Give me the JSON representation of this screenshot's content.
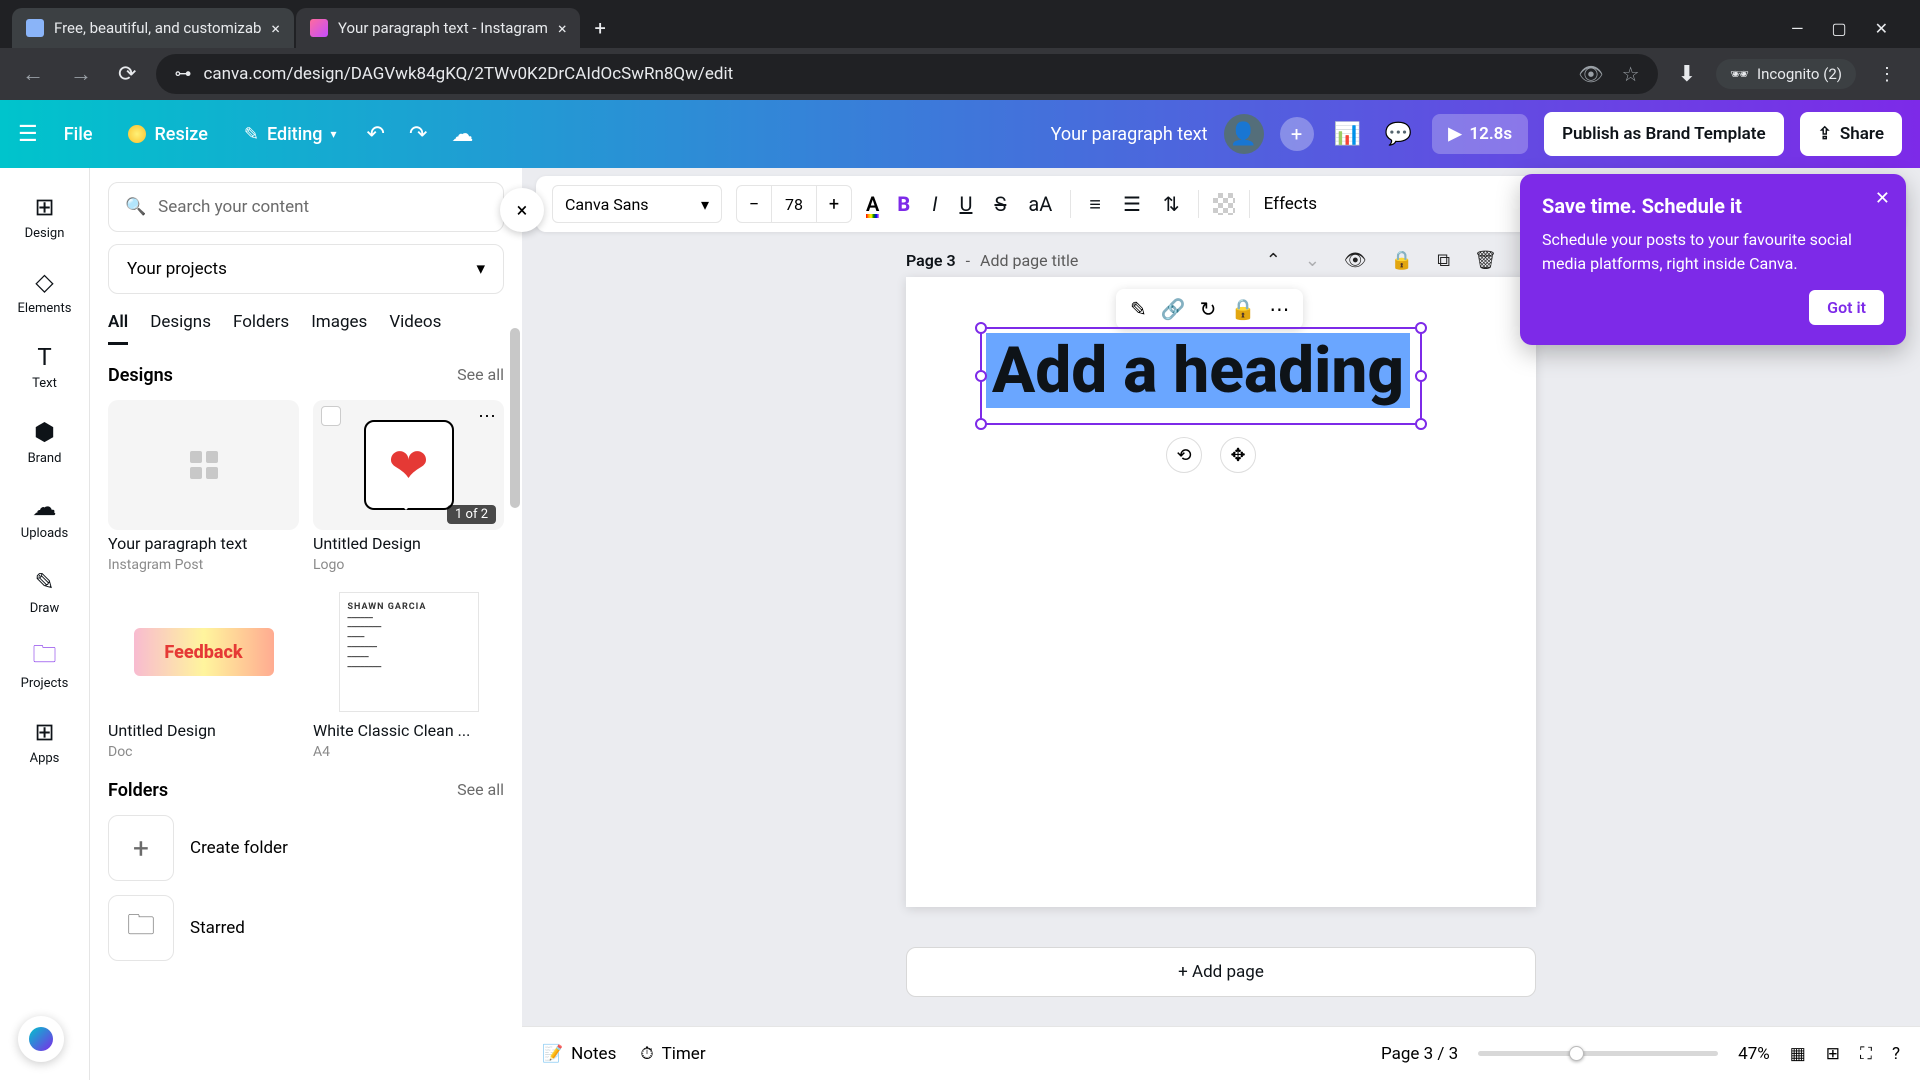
{
  "browser": {
    "tabs": [
      {
        "title": "Free, beautiful, and customizab",
        "active": false
      },
      {
        "title": "Your paragraph text - Instagram",
        "active": true
      }
    ],
    "url": "canva.com/design/DAGVwk84gKQ/2TWv0K2DrCAIdOcSwRn8Qw/edit",
    "incognito_label": "Incognito (2)"
  },
  "header": {
    "file": "File",
    "resize": "Resize",
    "editing": "Editing",
    "doc_title": "Your paragraph text",
    "duration": "12.8s",
    "publish": "Publish as Brand Template",
    "share": "Share"
  },
  "rail": [
    {
      "label": "Design",
      "icon": "⊞"
    },
    {
      "label": "Elements",
      "icon": "◇"
    },
    {
      "label": "Text",
      "icon": "T"
    },
    {
      "label": "Brand",
      "icon": "⬢"
    },
    {
      "label": "Uploads",
      "icon": "☁"
    },
    {
      "label": "Draw",
      "icon": "✎"
    },
    {
      "label": "Projects",
      "icon": "🗀",
      "active": true
    },
    {
      "label": "Apps",
      "icon": "⊞"
    }
  ],
  "panel": {
    "search_placeholder": "Search your content",
    "dropdown": "Your projects",
    "tabs": [
      "All",
      "Designs",
      "Folders",
      "Images",
      "Videos"
    ],
    "active_tab": "All",
    "designs_header": "Designs",
    "see_all": "See all",
    "designs": [
      {
        "title": "Your paragraph text",
        "subtitle": "Instagram Post",
        "kind": "grid"
      },
      {
        "title": "Untitled Design",
        "subtitle": "Logo",
        "kind": "heart",
        "badge": "1 of 2",
        "hover": true
      },
      {
        "title": "Untitled Design",
        "subtitle": "Doc",
        "kind": "feedback"
      },
      {
        "title": "White Classic Clean ...",
        "subtitle": "A4",
        "kind": "resume",
        "resume_name": "SHAWN GARCIA"
      }
    ],
    "folders_header": "Folders",
    "create_folder": "Create folder",
    "starred": "Starred"
  },
  "toolbar": {
    "font": "Canva Sans",
    "size": "78",
    "effects": "Effects"
  },
  "canvas": {
    "page_label": "Page 3",
    "page_title_placeholder": "Add page title",
    "heading_text": "Add a heading",
    "add_page": "+ Add page"
  },
  "tooltip": {
    "title": "Save time. Schedule it",
    "body": "Schedule your posts to your favourite social media platforms, right inside Canva.",
    "cta": "Got it"
  },
  "footer": {
    "notes": "Notes",
    "timer": "Timer",
    "page_of": "Page 3 / 3",
    "zoom": "47%"
  }
}
